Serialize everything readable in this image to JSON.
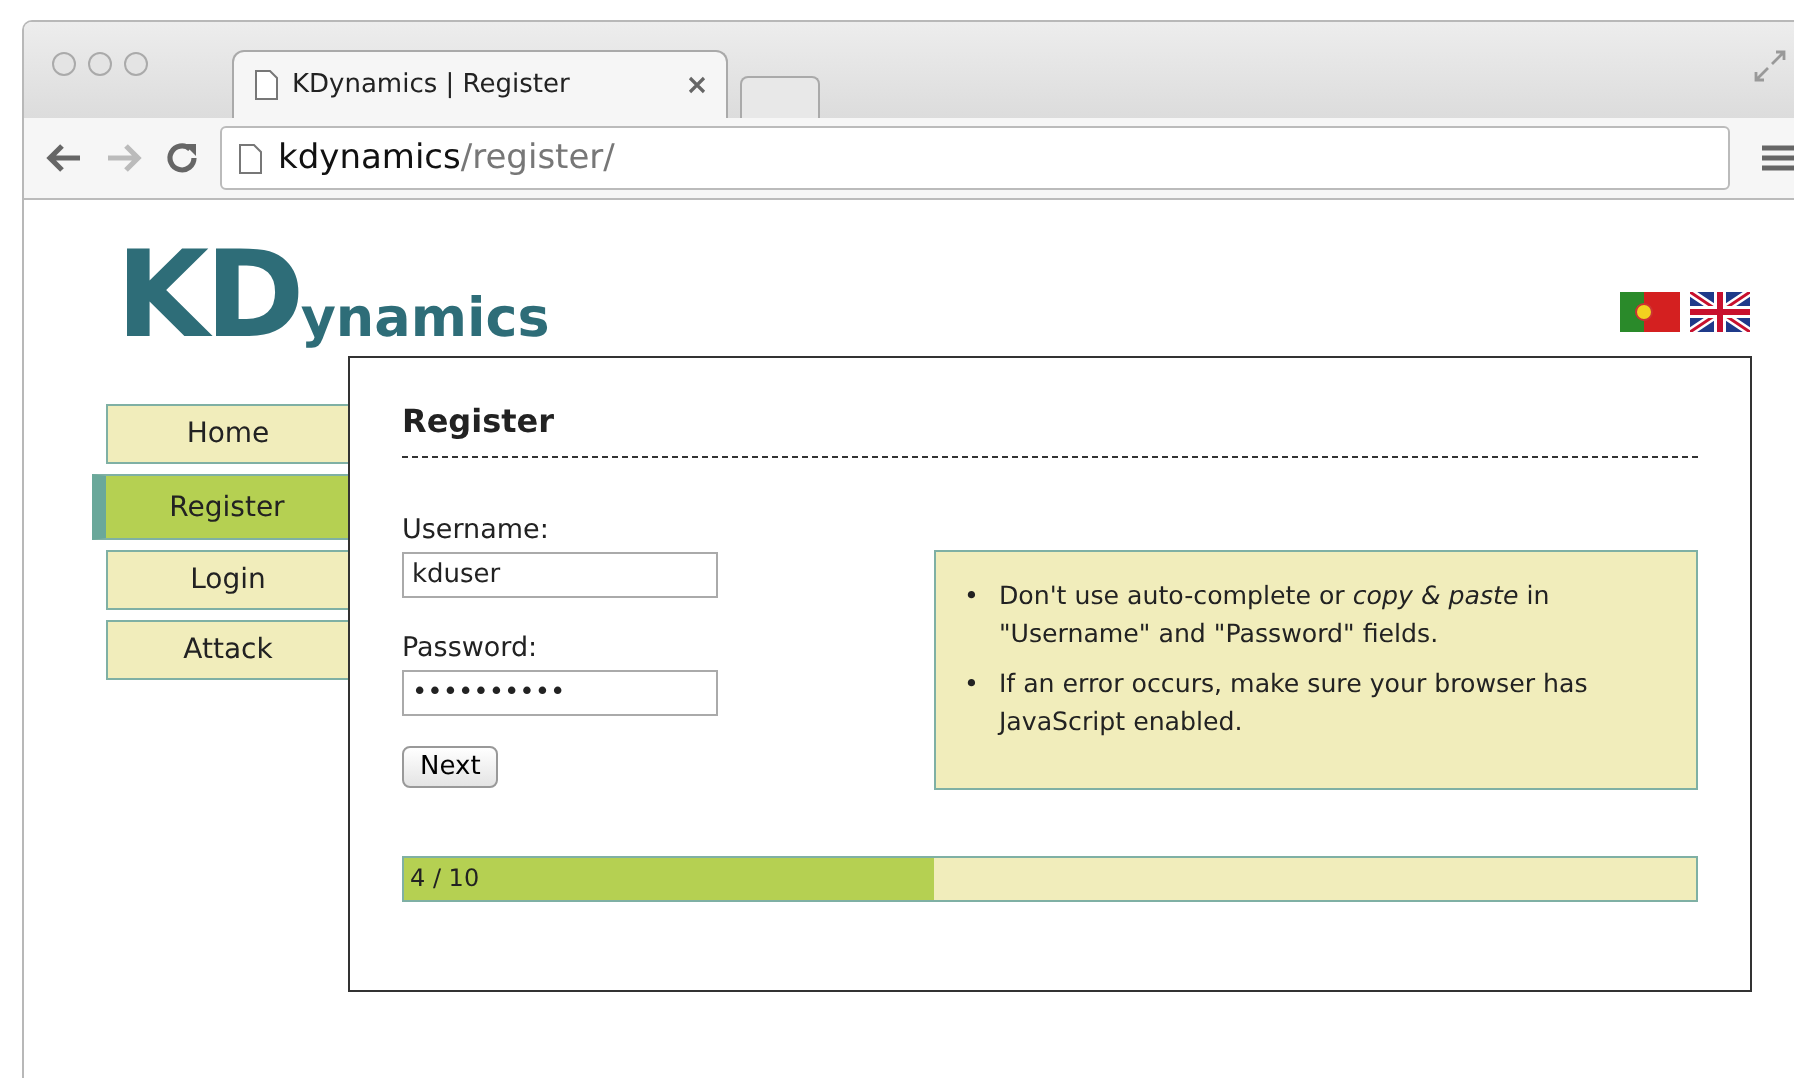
{
  "browser": {
    "tab_title": "KDynamics | Register",
    "url_host": "kdynamics",
    "url_path": "/register/"
  },
  "logo": {
    "initials": "KD",
    "rest": "ynamics"
  },
  "languages": [
    {
      "kind": "pt",
      "selected": false
    },
    {
      "kind": "uk",
      "selected": false
    }
  ],
  "nav": [
    {
      "label": "Home",
      "selected": false
    },
    {
      "label": "Register",
      "selected": true
    },
    {
      "label": "Login",
      "selected": false
    },
    {
      "label": "Attack",
      "selected": false
    }
  ],
  "form": {
    "title": "Register",
    "username_label": "Username:",
    "username_value": "kduser",
    "password_label": "Password:",
    "password_mask": "••••••••••",
    "button": "Next"
  },
  "notes": [
    {
      "bullet": "•",
      "text": "Don't use auto-complete or *copy & paste* in \"Username\" and \"Password\" fields."
    },
    {
      "bullet": "•",
      "text": "If an error occurs, make sure your browser has JavaScript enabled."
    }
  ],
  "progress": {
    "label": "4 / 10",
    "level": 0.41
  }
}
